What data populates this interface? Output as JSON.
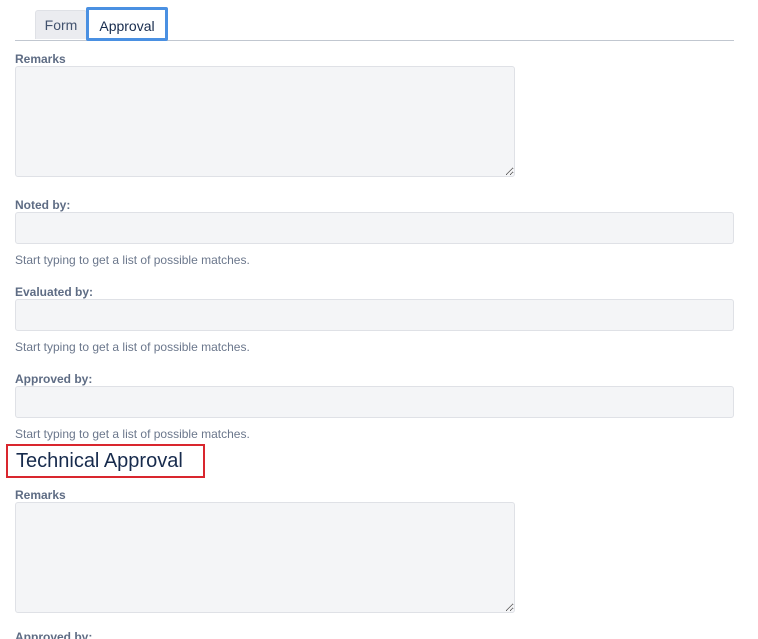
{
  "tabs": [
    {
      "label": "Form"
    },
    {
      "label": "Approval"
    }
  ],
  "approval": {
    "remarks_label": "Remarks",
    "remarks_value": "",
    "noted_by_label": "Noted by:",
    "noted_by_value": "",
    "noted_by_hint": "Start typing to get a list of possible matches.",
    "evaluated_by_label": "Evaluated by:",
    "evaluated_by_value": "",
    "evaluated_by_hint": "Start typing to get a list of possible matches.",
    "approved_by_label": "Approved by:",
    "approved_by_value": "",
    "approved_by_hint": "Start typing to get a list of possible matches."
  },
  "technical_approval": {
    "title": "Technical Approval",
    "remarks_label": "Remarks",
    "remarks_value": "",
    "next_label": "Approved by:"
  },
  "colors": {
    "active_tab_highlight": "#4a90e2",
    "section_highlight": "#d9262e",
    "field_background": "#f4f5f7"
  }
}
